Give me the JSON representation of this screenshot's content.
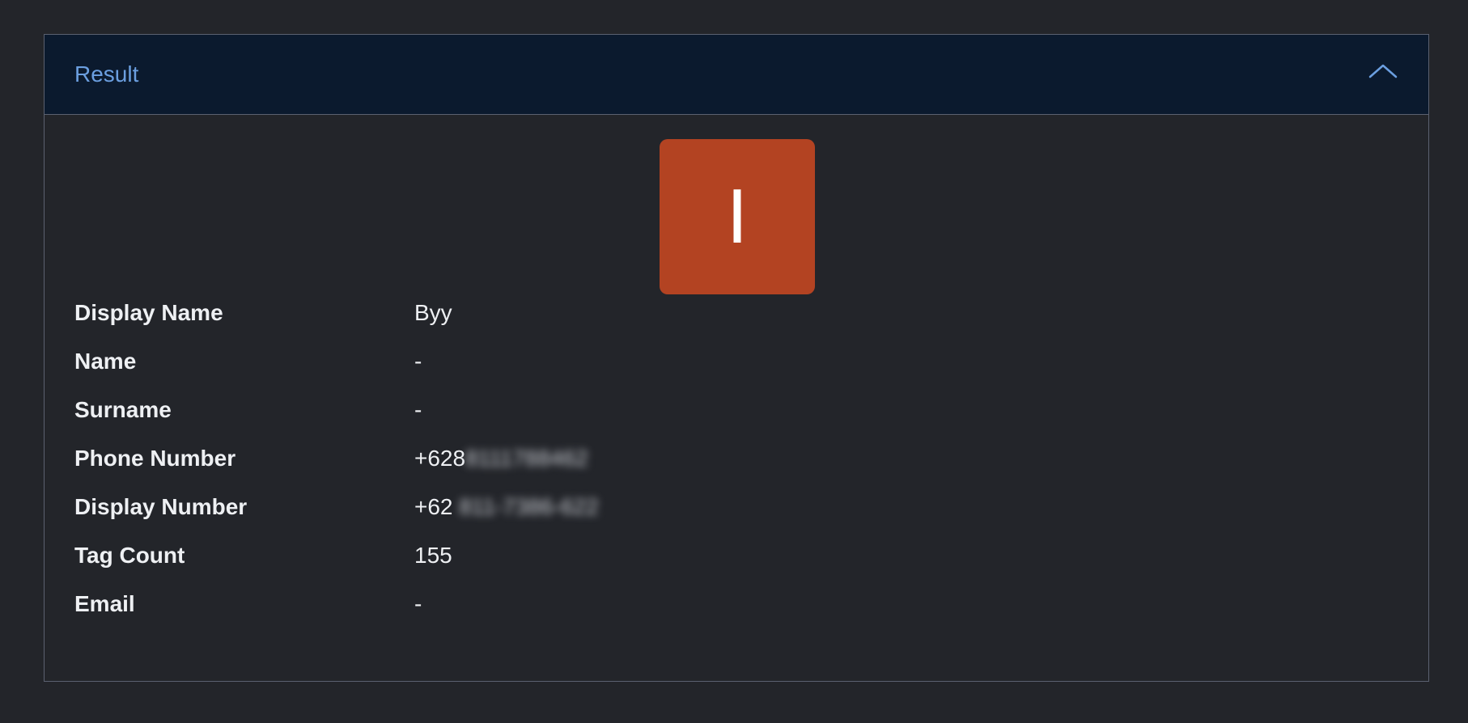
{
  "panel": {
    "title": "Result",
    "collapse_icon": "chevron-up-icon",
    "accent_color": "#6b9fe0",
    "header_background": "#0b1a2e"
  },
  "avatar": {
    "letter": "I",
    "background": "#b34322"
  },
  "details": [
    {
      "label": "Display Name",
      "value": "Byy"
    },
    {
      "label": "Name",
      "value": "-"
    },
    {
      "label": "Surname",
      "value": "-"
    },
    {
      "label": "Phone Number",
      "value": "+628",
      "value_redacted": "8111788462"
    },
    {
      "label": "Display Number",
      "value": "+62",
      "value_redacted": "811-7386-622"
    },
    {
      "label": "Tag Count",
      "value": "155"
    },
    {
      "label": "Email",
      "value": "-"
    }
  ]
}
